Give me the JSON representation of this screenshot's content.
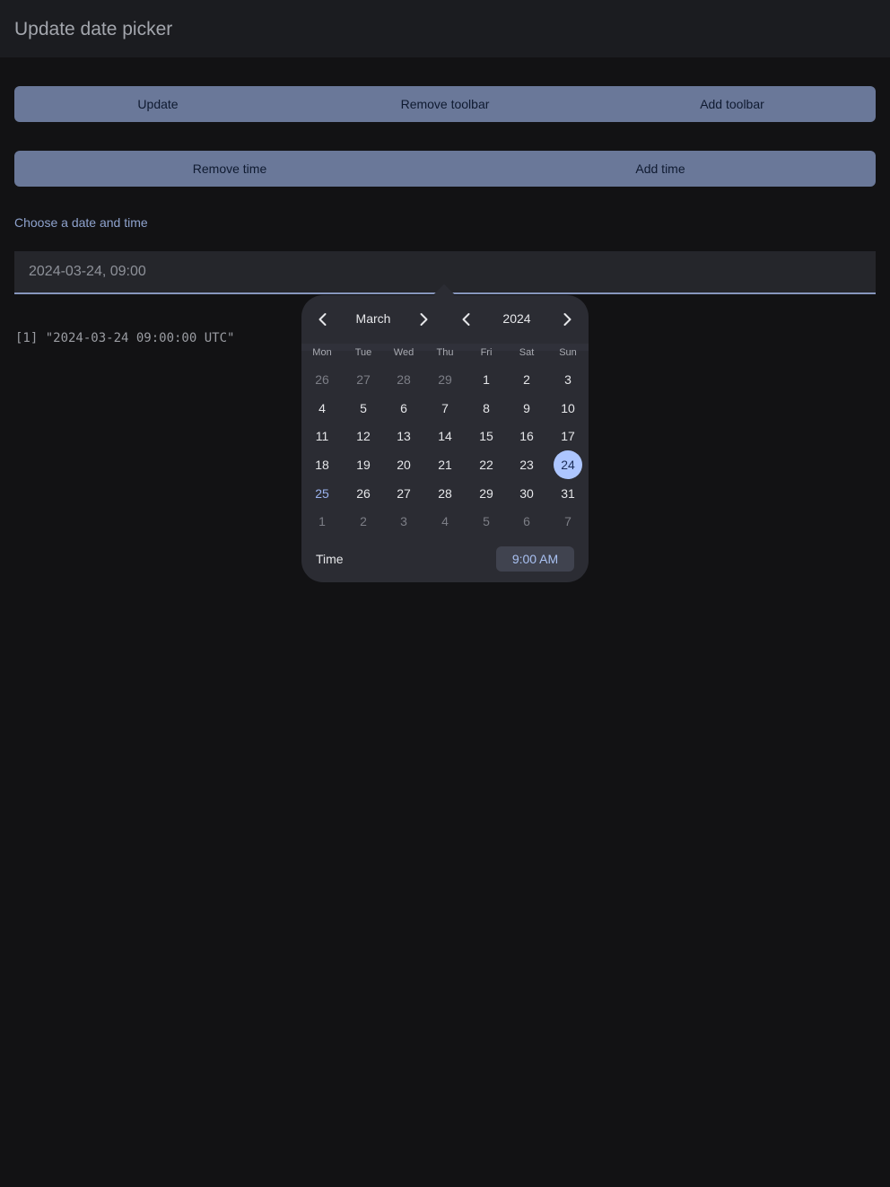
{
  "app": {
    "title": "Update date picker"
  },
  "toolbar_group": {
    "update_label": "Update",
    "remove_toolbar_label": "Remove toolbar",
    "add_toolbar_label": "Add toolbar"
  },
  "time_group": {
    "remove_time_label": "Remove time",
    "add_time_label": "Add time"
  },
  "field": {
    "label": "Choose a date and time",
    "value": "2024-03-24, 09:00"
  },
  "console": {
    "output": "[1] \"2024-03-24 09:00:00 UTC\""
  },
  "picker": {
    "month": "March",
    "year": "2024",
    "weekdays": [
      "Mon",
      "Tue",
      "Wed",
      "Thu",
      "Fri",
      "Sat",
      "Sun"
    ],
    "weeks": [
      [
        "26",
        "27",
        "28",
        "29",
        "1",
        "2",
        "3"
      ],
      [
        "4",
        "5",
        "6",
        "7",
        "8",
        "9",
        "10"
      ],
      [
        "11",
        "12",
        "13",
        "14",
        "15",
        "16",
        "17"
      ],
      [
        "18",
        "19",
        "20",
        "21",
        "22",
        "23",
        "24"
      ],
      [
        "25",
        "26",
        "27",
        "28",
        "29",
        "30",
        "31"
      ],
      [
        "1",
        "2",
        "3",
        "4",
        "5",
        "6",
        "7"
      ]
    ],
    "selected_day": "24",
    "today_day": "25",
    "time_label": "Time",
    "time_value": "9:00 AM",
    "icons": {
      "prev_month": "chevron-left-icon",
      "next_month": "chevron-right-icon",
      "prev_year": "chevron-left-icon",
      "next_year": "chevron-right-icon"
    }
  },
  "colors": {
    "background": "#121214",
    "button": "#6a7899",
    "accent": "#adc6ff",
    "picker_bg": "#2b2c33"
  }
}
